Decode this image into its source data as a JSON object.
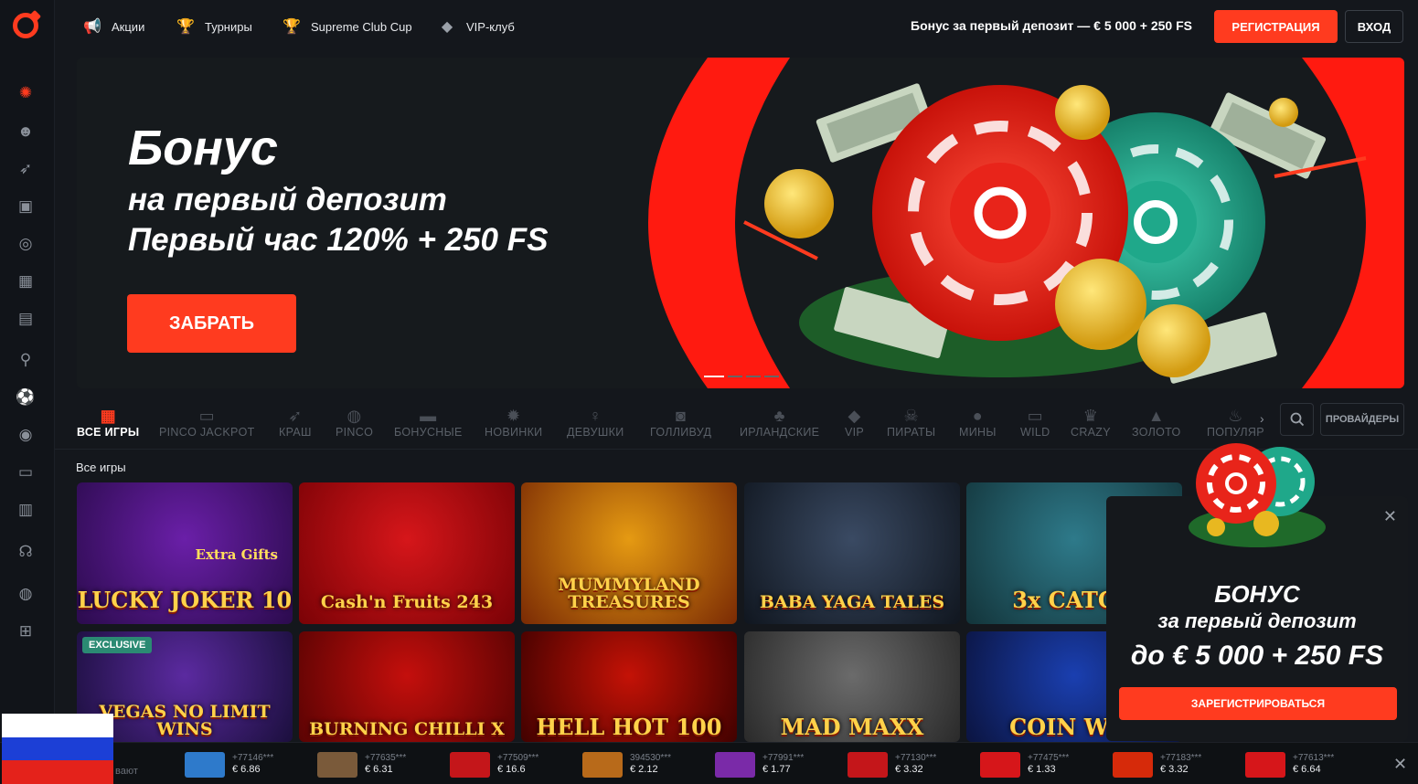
{
  "topnav": {
    "items": [
      {
        "label": "Акции",
        "icon": "megaphone-icon"
      },
      {
        "label": "Турниры",
        "icon": "trophy-icon"
      },
      {
        "label": "Supreme Club Cup",
        "icon": "cup-icon"
      },
      {
        "label": "VIP-клуб",
        "icon": "diamond-icon"
      }
    ],
    "bonus_text": "Бонус за первый депозит — € 5 000 + 250 FS",
    "register_label": "РЕГИСТРАЦИЯ",
    "login_label": "ВХОД"
  },
  "sidebar": {
    "icons": [
      "casino-chip-icon",
      "live-dealer-icon",
      "rocket-icon",
      "tv-games-icon",
      "roulette-icon",
      "bingo-icon",
      "cards-icon",
      "sports-icon",
      "football-icon",
      "target-icon",
      "gamepad-icon",
      "book-icon",
      "support-icon",
      "pinco-icon",
      "gift-icon"
    ]
  },
  "hero": {
    "title": "Бонус",
    "line1": "на первый депозит",
    "line2": "Первый час 120% + 250 FS",
    "cta": "ЗАБРАТЬ",
    "slides_total": 4,
    "slide_active": 1
  },
  "categories": [
    {
      "label": "ВСЕ ИГРЫ",
      "icon": "grid-icon",
      "active": true
    },
    {
      "label": "PINCO JACKPOT",
      "icon": "jackpot-icon"
    },
    {
      "label": "КРАШ",
      "icon": "rocket-icon"
    },
    {
      "label": "PINCO",
      "icon": "pinco-icon"
    },
    {
      "label": "БОНУСНЫЕ",
      "icon": "bonus-icon"
    },
    {
      "label": "НОВИНКИ",
      "icon": "new-icon"
    },
    {
      "label": "ДЕВУШКИ",
      "icon": "girl-icon"
    },
    {
      "label": "ГОЛЛИВУД",
      "icon": "camera-icon"
    },
    {
      "label": "ИРЛАНДСКИЕ",
      "icon": "clover-icon"
    },
    {
      "label": "VIP",
      "icon": "vip-icon"
    },
    {
      "label": "ПИРАТЫ",
      "icon": "skull-icon"
    },
    {
      "label": "МИНЫ",
      "icon": "mine-icon"
    },
    {
      "label": "WILD",
      "icon": "wild-icon"
    },
    {
      "label": "CRAZY",
      "icon": "jester-icon"
    },
    {
      "label": "ЗОЛОТО",
      "icon": "gold-icon"
    },
    {
      "label": "ПОПУЛЯР",
      "icon": "fire-icon"
    }
  ],
  "providers_label": "ПРОВАЙДЕРЫ",
  "section_title": "Все игры",
  "games": [
    {
      "title": "LUCKY JOKER 10",
      "extra": "Extra Gifts",
      "c1": "#6a1fa8",
      "c2": "#2b0b4d"
    },
    {
      "title": "Cash'n Fruits 243",
      "extra": "",
      "c1": "#d6161a",
      "c2": "#7a0206"
    },
    {
      "title": "MUMMYLAND TREASURES",
      "extra": "",
      "c1": "#e59a12",
      "c2": "#7a2a04"
    },
    {
      "title": "BABA YAGA TALES",
      "extra": "",
      "c1": "#3a4a63",
      "c2": "#10161f"
    },
    {
      "title": "3x CATCH",
      "extra": "",
      "c1": "#2e7a8a",
      "c2": "#13343a"
    },
    {
      "title": "VEGAS NO LIMIT WINS",
      "extra": "EXCLUSIVE",
      "c1": "#5b2aa0",
      "c2": "#1b0f3d"
    },
    {
      "title": "BURNING CHILLI X",
      "extra": "",
      "c1": "#c40f0c",
      "c2": "#5a0303"
    },
    {
      "title": "HELL HOT 100",
      "extra": "",
      "c1": "#c41206",
      "c2": "#410100"
    },
    {
      "title": "MAD MAXX",
      "extra": "",
      "c1": "#6b6b6b",
      "c2": "#2a2a2a"
    },
    {
      "title": "COIN WIN",
      "extra": "",
      "c1": "#1a3fb0",
      "c2": "#0b1440"
    }
  ],
  "popup": {
    "line1": "БОНУС",
    "line2": "за первый депозит",
    "line3": "до € 5 000 + 250 FS",
    "cta": "ЗАРЕГИСТРИРОВАТЬСЯ"
  },
  "ticker": {
    "cut_text": "вают",
    "winners": [
      {
        "user": "+77146***",
        "amount": "€ 6.86",
        "color": "#2e7acb"
      },
      {
        "user": "+77635***",
        "amount": "€ 6.31",
        "color": "#7a5a3a"
      },
      {
        "user": "+77509***",
        "amount": "€ 16.6",
        "color": "#c4161a"
      },
      {
        "user": "394530***",
        "amount": "€ 2.12",
        "color": "#b86a1a"
      },
      {
        "user": "+77991***",
        "amount": "€ 1.77",
        "color": "#7a2aa8"
      },
      {
        "user": "+77130***",
        "amount": "€ 3.32",
        "color": "#c4161a"
      },
      {
        "user": "+77475***",
        "amount": "€ 1.33",
        "color": "#d6161a"
      },
      {
        "user": "+77183***",
        "amount": "€ 3.32",
        "color": "#d62a0a"
      },
      {
        "user": "+77613***",
        "amount": "€ 6.64",
        "color": "#d6161a"
      }
    ]
  },
  "colors": {
    "accent": "#ff3b1f",
    "background": "#14171c",
    "sidebar": "#111419"
  }
}
